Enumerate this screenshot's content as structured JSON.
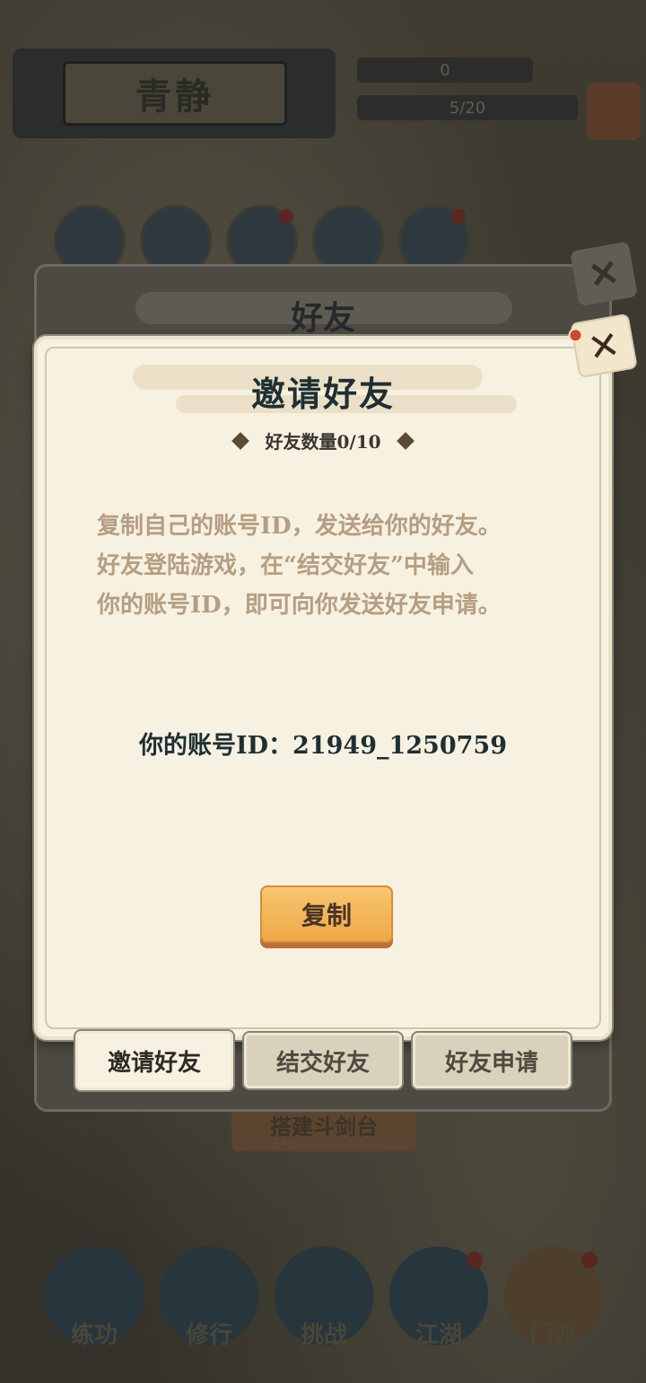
{
  "player": {
    "name": "青静"
  },
  "stats": {
    "currency": "0",
    "energy": "5/20"
  },
  "background": {
    "button_label": "搭建斗剑台",
    "nav": [
      {
        "label": "练功",
        "has_dot": false
      },
      {
        "label": "修行",
        "has_dot": false
      },
      {
        "label": "挑战",
        "has_dot": false
      },
      {
        "label": "江湖",
        "has_dot": true
      },
      {
        "label": "门派",
        "has_dot": true
      }
    ]
  },
  "friends_panel": {
    "title": "好友"
  },
  "invite_dialog": {
    "title": "邀请好友",
    "friend_count_label": "好友数量0/10",
    "instructions": [
      "复制自己的账号ID，发送给你的好友。",
      "好友登陆游戏，在“结交好友”中输入",
      "你的账号ID，即可向你发送好友申请。"
    ],
    "account_id_label": "你的账号ID：",
    "account_id": "21949_1250759",
    "copy_label": "复制"
  },
  "tabs": [
    {
      "label": "邀请好友",
      "active": true
    },
    {
      "label": "结交好友",
      "active": false
    },
    {
      "label": "好友申请",
      "active": false
    }
  ],
  "colors": {
    "dialog_bg": "#f7f1e1",
    "title_text": "#1f2f33",
    "instruction_text": "#b59e82",
    "copy_button": "#eea849",
    "close_tag": "#d04a2c"
  }
}
